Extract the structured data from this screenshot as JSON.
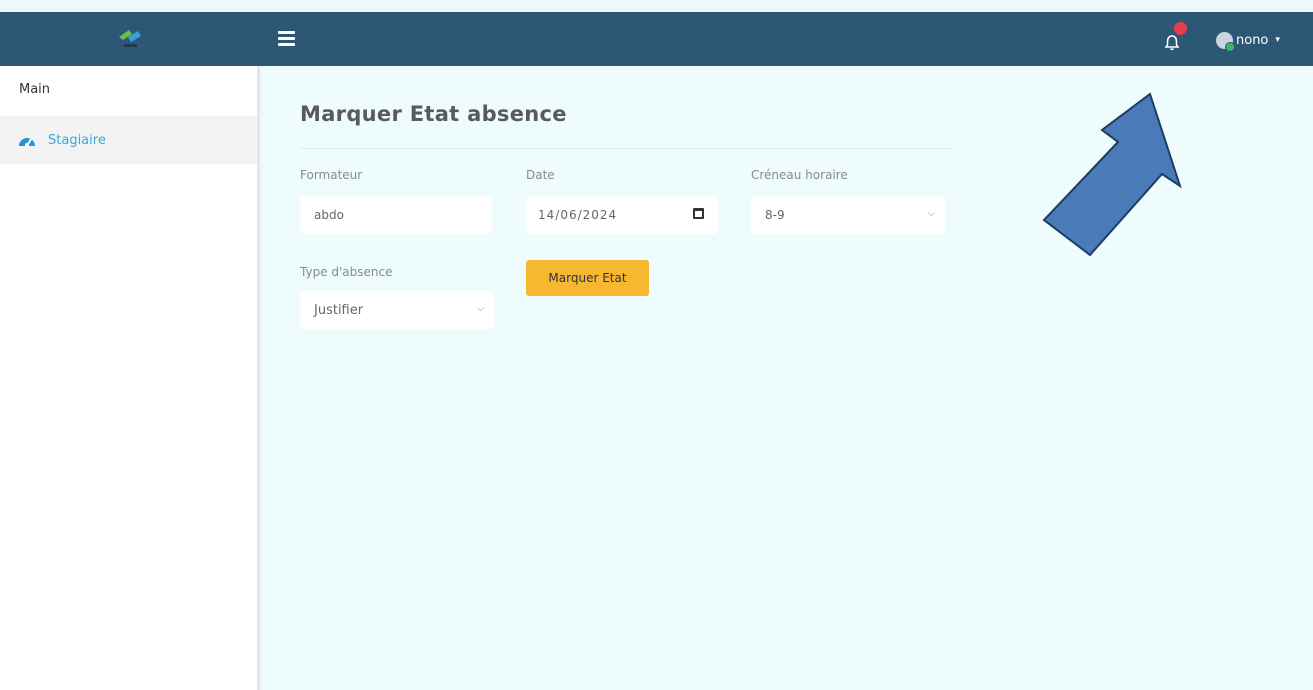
{
  "header": {
    "menu_icon": "hamburger-icon",
    "notification_icon": "bell-icon",
    "user": {
      "name": "nono",
      "caret": "▾"
    }
  },
  "sidebar": {
    "section": "Main",
    "items": [
      {
        "label": "Stagiaire",
        "icon": "dashboard-icon"
      }
    ]
  },
  "main": {
    "title": "Marquer Etat absence",
    "form": {
      "formateur": {
        "label": "Formateur",
        "value": "abdo"
      },
      "date": {
        "label": "Date",
        "value": "14/06/2024"
      },
      "creneau": {
        "label": "Créneau horaire",
        "value": "8-9"
      },
      "type_absence": {
        "label": "Type d'absence",
        "value": "Justifier"
      },
      "submit_label": "Marquer Etat"
    }
  },
  "colors": {
    "topbar": "#2c5775",
    "accent_link": "#3aa8e0",
    "button": "#f6b731",
    "badge": "#e43e4f",
    "annotation_arrow": "#4a7ab8"
  }
}
